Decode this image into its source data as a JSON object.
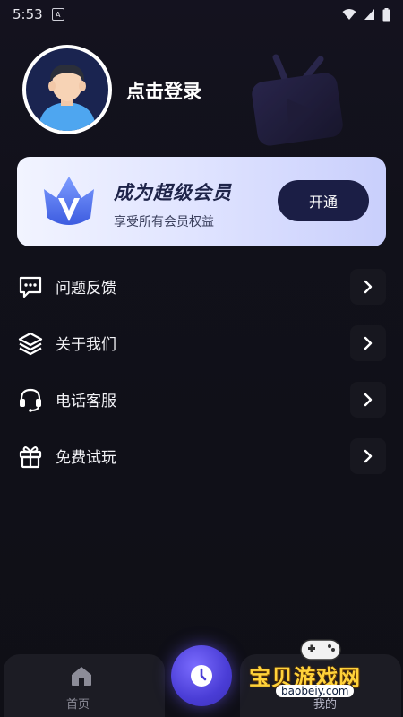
{
  "status_bar": {
    "time": "5:53",
    "notification_glyph": "A"
  },
  "profile": {
    "login_text": "点击登录"
  },
  "vip": {
    "title": "成为超级会员",
    "subtitle": "享受所有会员权益",
    "button_label": "开通",
    "accent_color": "#1b1e45"
  },
  "menu": {
    "items": [
      {
        "label": "问题反馈",
        "icon": "message-icon"
      },
      {
        "label": "关于我们",
        "icon": "layers-icon"
      },
      {
        "label": "电话客服",
        "icon": "headset-icon"
      },
      {
        "label": "免费试玩",
        "icon": "gift-icon"
      }
    ]
  },
  "tabbar": {
    "home_label": "首页",
    "center_icon": "clock-icon",
    "mine_label": "我的"
  },
  "watermark": {
    "text": "宝贝游戏网",
    "url": "baobeiy.com"
  }
}
